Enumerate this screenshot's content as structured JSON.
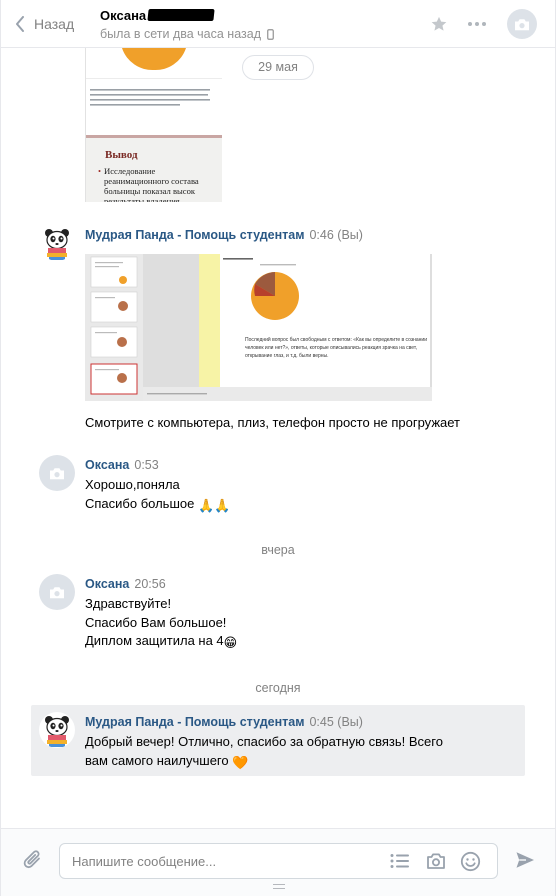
{
  "header": {
    "back_label": "Назад",
    "peer_name": "Оксана",
    "peer_status": "была в сети два часа назад"
  },
  "date_pill": "29 мая",
  "doc_preview": {
    "heading": "Вывод",
    "bullet_text": "Исследование реанимационного состава больницы показал высок результаты владения информаци"
  },
  "messages": [
    {
      "author": "Мудрая Панда - Помощь студентам",
      "time": "0:46 (Вы)",
      "attachment": "screenshot",
      "attachment_caption": "Последний вопрос был свободным с ответом: «Как вы определите в сознании человек или нет?», ответы, которые описывались реакция зрачка на свет, открывание глаз, и т.д. были верны.",
      "lines": [
        "Смотрите с компьютера, плиз, телефон просто не прогружает"
      ]
    },
    {
      "author": "Оксана",
      "time": "0:53",
      "lines": [
        "Хорошо,поняла",
        "Спасибо большое"
      ],
      "emoji": "🙏🙏"
    },
    {
      "author": "Оксана",
      "time": "20:56",
      "lines": [
        "Здравствуйте!",
        "Спасибо Вам большое!",
        "Диплом защитила на 4"
      ],
      "emoji": "😁"
    },
    {
      "author": "Мудрая Панда - Помощь студентам",
      "time": "0:45 (Вы)",
      "lines": [
        "Добрый вечер! Отлично, спасибо за обратную связь! Всего",
        "вам самого наилучшего"
      ],
      "emoji": "🧡"
    }
  ],
  "separators": {
    "yesterday": "вчера",
    "today": "сегодня"
  },
  "composer": {
    "placeholder": "Напишите сообщение..."
  },
  "colors": {
    "link": "#2a5885",
    "muted": "#828282",
    "highlight": "#edeef0"
  }
}
